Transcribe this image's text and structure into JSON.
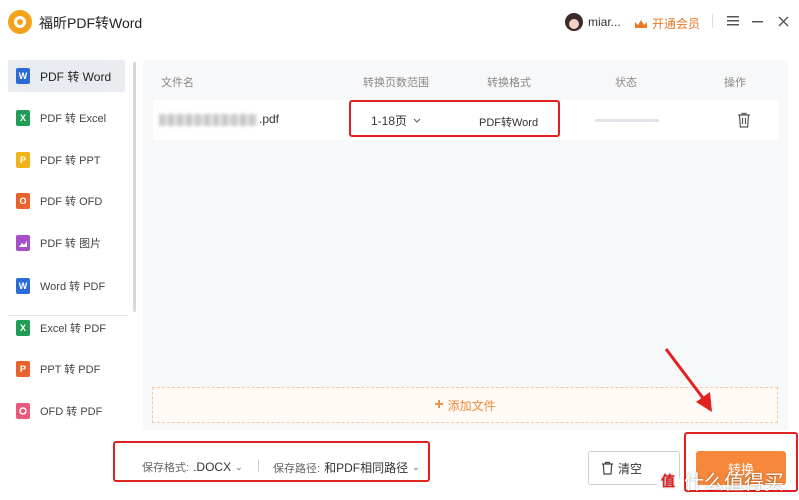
{
  "app": {
    "title": "福昕PDF转Word",
    "username": "miar...",
    "vip_label": "开通会员"
  },
  "sidebar": {
    "items": [
      {
        "label": "PDF 转 Word",
        "icon": "word-icon",
        "badge": "W",
        "color": "#2b6bd6"
      },
      {
        "label": "PDF 转 Excel",
        "icon": "excel-icon",
        "badge": "X",
        "color": "#1f9d55"
      },
      {
        "label": "PDF 转 PPT",
        "icon": "ppt-icon",
        "badge": "P",
        "color": "#f2b21a"
      },
      {
        "label": "PDF 转 OFD",
        "icon": "ofd-icon",
        "badge": "O",
        "color": "#e8622c"
      },
      {
        "label": "PDF 转 图片",
        "icon": "image-icon",
        "badge": "",
        "color": "#a64fc9"
      },
      {
        "label": "Word 转 PDF",
        "icon": "word-to-pdf-icon",
        "badge": "W",
        "color": "#2b6bd6"
      },
      {
        "label": "Excel 转 PDF",
        "icon": "excel-to-pdf-icon",
        "badge": "X",
        "color": "#1f9d55"
      },
      {
        "label": "PPT 转 PDF",
        "icon": "ppt-to-pdf-icon",
        "badge": "P",
        "color": "#e8622c"
      },
      {
        "label": "OFD 转 PDF",
        "icon": "ofd-to-pdf-icon",
        "badge": "",
        "color": "#e85a7a"
      }
    ]
  },
  "table": {
    "headers": {
      "name": "文件名",
      "range": "转换页数范围",
      "format": "转换格式",
      "status": "状态",
      "action": "操作"
    },
    "rows": [
      {
        "file_suffix": ".pdf",
        "range": "1-18页",
        "format": "PDF转Word",
        "progress": 0
      }
    ]
  },
  "add_file_label": "添加文件",
  "footer": {
    "format_label": "保存格式:",
    "format_value": ".DOCX",
    "path_label": "保存路径:",
    "path_value": "和PDF相同路径",
    "clear_label": "清空",
    "convert_label": "转换"
  },
  "watermark": {
    "text": "什么值得买",
    "symbol": "值"
  },
  "colors": {
    "accent": "#f5883a",
    "highlight": "#e0211f",
    "active_bg": "#e8ecf1"
  }
}
